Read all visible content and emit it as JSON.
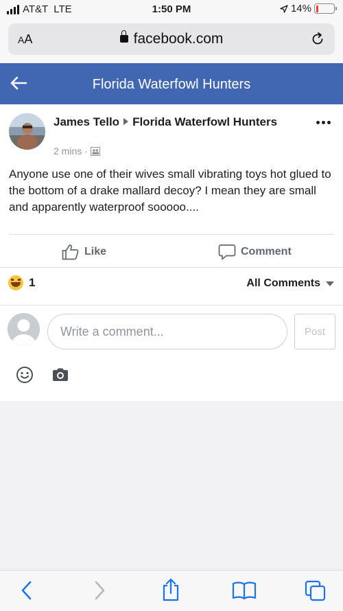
{
  "status_bar": {
    "carrier": "AT&T",
    "network": "LTE",
    "time": "1:50 PM",
    "battery": "14%",
    "battery_level": 0.14,
    "battery_color": "#ff3b30"
  },
  "browser": {
    "text_size_label_small": "A",
    "text_size_label_large": "A",
    "url": "facebook.com",
    "lock_icon": "lock-icon",
    "reload_icon": "reload-icon"
  },
  "header": {
    "title": "Florida Waterfowl Hunters",
    "back_icon": "back-arrow-icon",
    "color": "#4267b2"
  },
  "post": {
    "author": "James Tello",
    "group": "Florida Waterfowl Hunters",
    "time": "2 mins ·",
    "text": "Anyone use one of their wives small vibrating toys hot glued to the bottom of a drake mallard decoy? I mean they are small and apparently waterproof sooooo....",
    "actions": {
      "like": "Like",
      "comment": "Comment"
    },
    "reactions": {
      "icon": "haha-emoji-icon",
      "count": "1"
    },
    "comments_filter": "All Comments"
  },
  "comment_box": {
    "placeholder": "Write a comment...",
    "post_label": "Post"
  },
  "toolbar": {
    "icons": [
      "back-icon",
      "forward-icon",
      "share-icon",
      "bookmarks-icon",
      "tabs-icon"
    ],
    "accent": "#1a73e8"
  }
}
